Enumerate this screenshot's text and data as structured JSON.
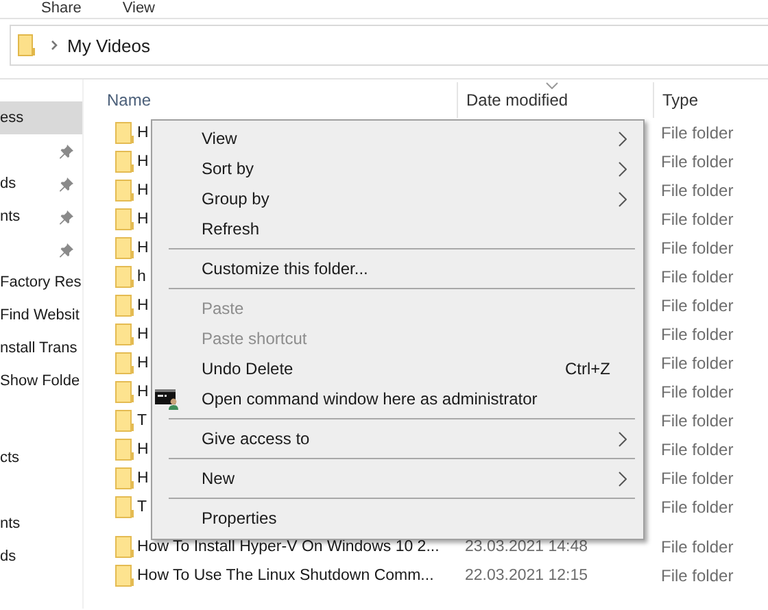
{
  "ribbon_tabs": [
    {
      "label": "Share"
    },
    {
      "label": "View"
    }
  ],
  "address_bar": {
    "path": "My Videos"
  },
  "sidebar": {
    "items": [
      {
        "label": "ess",
        "selected": true
      },
      {
        "selected": false,
        "pinned": true
      },
      {
        "label": "ds",
        "selected": false,
        "pinned": true
      },
      {
        "label": "nts",
        "selected": false,
        "pinned": true
      },
      {
        "selected": false,
        "pinned": true
      },
      {
        "label": "Factory Res",
        "selected": false
      },
      {
        "label": "Find Websit",
        "selected": false
      },
      {
        "label": "nstall Trans",
        "selected": false
      },
      {
        "label": "Show Folde",
        "selected": false
      },
      {
        "label": "cts",
        "selected": false
      },
      {
        "label": "nts",
        "selected": false
      },
      {
        "label": "ds",
        "selected": false
      }
    ]
  },
  "file_list": {
    "columns": [
      "Name",
      "Date modified",
      "Type"
    ],
    "rows": [
      {
        "name": "H",
        "type": "File folder"
      },
      {
        "name": "H",
        "type": "File folder"
      },
      {
        "name": "H",
        "type": "File folder"
      },
      {
        "name": "H",
        "type": "File folder"
      },
      {
        "name": "H",
        "type": "File folder"
      },
      {
        "name": "h",
        "type": "File folder"
      },
      {
        "name": "H",
        "type": "File folder"
      },
      {
        "name": "H",
        "type": "File folder"
      },
      {
        "name": "H",
        "type": "File folder"
      },
      {
        "name": "H",
        "type": "File folder"
      },
      {
        "name": "T",
        "type": "File folder"
      },
      {
        "name": "H",
        "type": "File folder"
      },
      {
        "name": "H",
        "type": "File folder"
      },
      {
        "name": "T",
        "type": "File folder"
      },
      {
        "name": "How To Install Hyper-V On Windows 10 2...",
        "date": "23.03.2021 14:48",
        "type": "File folder"
      },
      {
        "name": "How To Use The Linux Shutdown Comm...",
        "date": "22.03.2021 12:15",
        "type": "File folder"
      }
    ]
  },
  "context_menu": {
    "items": [
      {
        "kind": "item",
        "label": "View",
        "disabled": false,
        "submenu": true
      },
      {
        "kind": "item",
        "label": "Sort by",
        "disabled": false,
        "submenu": true
      },
      {
        "kind": "item",
        "label": "Group by",
        "disabled": false,
        "submenu": true
      },
      {
        "kind": "item",
        "label": "Refresh",
        "disabled": false,
        "submenu": false
      },
      {
        "kind": "separator"
      },
      {
        "kind": "item",
        "label": "Customize this folder...",
        "disabled": false,
        "submenu": false
      },
      {
        "kind": "separator"
      },
      {
        "kind": "item",
        "label": "Paste",
        "disabled": true,
        "submenu": false
      },
      {
        "kind": "item",
        "label": "Paste shortcut",
        "disabled": true,
        "submenu": false
      },
      {
        "kind": "item",
        "label": "Undo Delete",
        "disabled": false,
        "submenu": false,
        "shortcut": "Ctrl+Z"
      },
      {
        "kind": "icon_item",
        "label": "Open command window here as administrator",
        "disabled": false,
        "submenu": false
      },
      {
        "kind": "separator"
      },
      {
        "kind": "item",
        "label": "Give access to",
        "disabled": false,
        "submenu": true
      },
      {
        "kind": "separator"
      },
      {
        "kind": "item",
        "label": "New",
        "disabled": false,
        "submenu": true
      },
      {
        "kind": "separator"
      },
      {
        "kind": "item",
        "label": "Properties",
        "disabled": false,
        "submenu": false
      }
    ]
  }
}
